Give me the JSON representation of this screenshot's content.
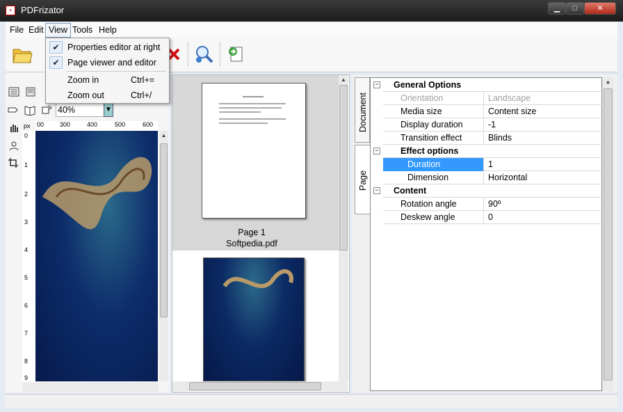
{
  "window": {
    "title": "PDFrizator",
    "icon": "pdf-app-icon",
    "controls": [
      "minimize",
      "maximize",
      "close"
    ]
  },
  "menu": {
    "items": [
      {
        "label": "File"
      },
      {
        "label": "Edit"
      },
      {
        "label": "View"
      },
      {
        "label": "Tools"
      },
      {
        "label": "Help"
      }
    ],
    "open_menu": "View"
  },
  "view_menu": {
    "items": [
      {
        "label": "Properties editor at right",
        "checked": true,
        "shortcut": ""
      },
      {
        "label": "Page viewer and editor",
        "checked": true,
        "shortcut": ""
      },
      {
        "label": "Zoom in",
        "checked": false,
        "shortcut": "Ctrl+="
      },
      {
        "label": "Zoom out",
        "checked": false,
        "shortcut": "Ctrl+/"
      }
    ]
  },
  "toolbar": {
    "icons": [
      "open-folder-icon",
      "save-icon",
      "delete-icon",
      "zoom-search-icon",
      "export-icon"
    ]
  },
  "left_panel": {
    "zoom_value": "40%",
    "ruler_unit": "px",
    "ruler_top_labels": [
      "00",
      "300",
      "400",
      "500",
      "600"
    ],
    "ruler_left_labels": [
      "0",
      "1",
      "2",
      "3",
      "4",
      "5",
      "6",
      "7",
      "8",
      "9"
    ]
  },
  "thumbnails": {
    "page_label": "Page 1",
    "file_name": "Softpedia.pdf"
  },
  "side_tabs": [
    "Document",
    "Page"
  ],
  "properties": {
    "rows": [
      {
        "type": "category",
        "name": "General Options",
        "indent": 0
      },
      {
        "type": "prop",
        "name": "Orientation",
        "value": "Landscape",
        "disabled": true,
        "indent": 1
      },
      {
        "type": "prop",
        "name": "Media size",
        "value": "Content size",
        "indent": 1
      },
      {
        "type": "prop",
        "name": "Display duration",
        "value": "-1",
        "indent": 1
      },
      {
        "type": "prop",
        "name": "Transition effect",
        "value": "Blinds",
        "indent": 1
      },
      {
        "type": "category",
        "name": "Effect options",
        "indent": 1
      },
      {
        "type": "prop",
        "name": "Duration",
        "value": "1",
        "selected": true,
        "indent": 2
      },
      {
        "type": "prop",
        "name": "Dimension",
        "value": "Horizontal",
        "indent": 2
      },
      {
        "type": "category",
        "name": "Content",
        "indent": 0
      },
      {
        "type": "prop",
        "name": "Rotation angle",
        "value": "90º",
        "indent": 1
      },
      {
        "type": "prop",
        "name": "Deskew angle",
        "value": "0",
        "indent": 1
      }
    ]
  },
  "colors": {
    "selection": "#3399ff",
    "titlebar": "#2a2a2a",
    "page_bg": "#0d2c6a"
  }
}
